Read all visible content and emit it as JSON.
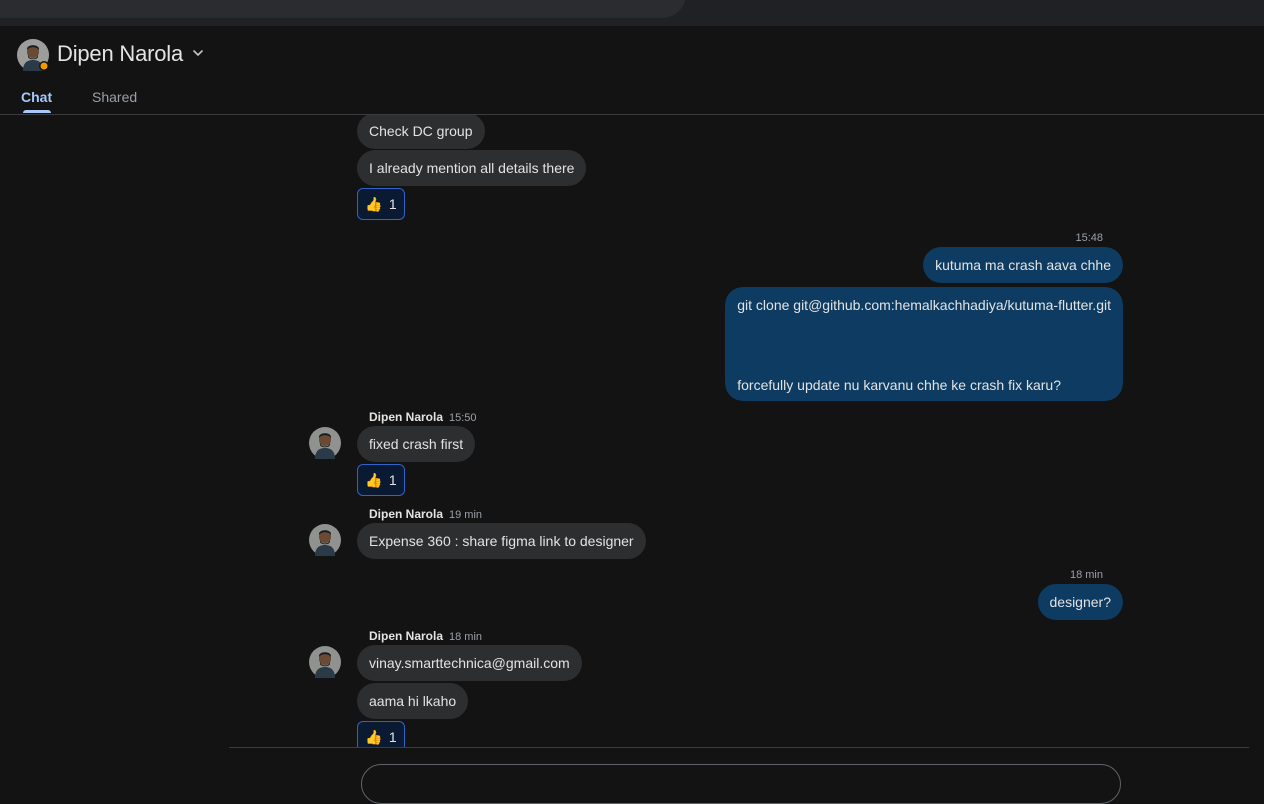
{
  "contact": {
    "name": "Dipen Narola"
  },
  "tabs": {
    "chat": "Chat",
    "shared": "Shared"
  },
  "messages": {
    "m1": "Check DC group",
    "m2": "I already mention all details there",
    "r1_emoji": "👍",
    "r1_count": "1",
    "t_out1": "15:48",
    "out1": "kutuma ma crash aava chhe",
    "out2_line1": "git clone git@github.com:hemalkachhadiya/kutuma-flutter.git",
    "out2_line2": "forcefully update nu karvanu chhe ke crash fix karu?",
    "s2_name": "Dipen Narola",
    "s2_time": "15:50",
    "m3": "fixed crash first",
    "r2_emoji": "👍",
    "r2_count": "1",
    "s3_name": "Dipen Narola",
    "s3_time": "19 min",
    "m4": "Expense 360 : share figma link to designer",
    "t_out2": "18 min",
    "out3": "designer?",
    "s4_name": "Dipen Narola",
    "s4_time": "18 min",
    "m5": "vinay.smarttechnica@gmail.com",
    "m6": "aama hi lkaho",
    "r3_emoji": "👍",
    "r3_count": "1"
  },
  "colors": {
    "background": "#131314",
    "incoming_bubble": "#2d2e30",
    "outgoing_bubble": "#0d3b61",
    "accent": "#a8c7fa",
    "reaction_border": "#2f63c9"
  },
  "icons": {
    "chevron": "chevron-down-icon",
    "avatar": "avatar",
    "status": "status-dot-icon"
  }
}
